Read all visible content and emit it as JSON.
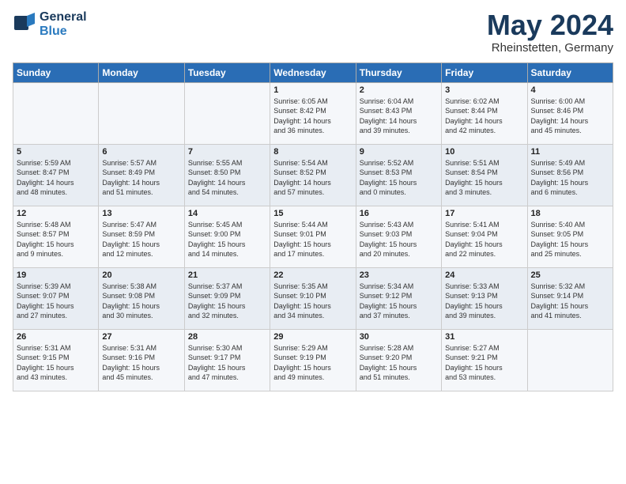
{
  "header": {
    "logo_line1": "General",
    "logo_line2": "Blue",
    "month": "May 2024",
    "location": "Rheinstetten, Germany"
  },
  "weekdays": [
    "Sunday",
    "Monday",
    "Tuesday",
    "Wednesday",
    "Thursday",
    "Friday",
    "Saturday"
  ],
  "weeks": [
    [
      {
        "day": "",
        "info": ""
      },
      {
        "day": "",
        "info": ""
      },
      {
        "day": "",
        "info": ""
      },
      {
        "day": "1",
        "info": "Sunrise: 6:05 AM\nSunset: 8:42 PM\nDaylight: 14 hours\nand 36 minutes."
      },
      {
        "day": "2",
        "info": "Sunrise: 6:04 AM\nSunset: 8:43 PM\nDaylight: 14 hours\nand 39 minutes."
      },
      {
        "day": "3",
        "info": "Sunrise: 6:02 AM\nSunset: 8:44 PM\nDaylight: 14 hours\nand 42 minutes."
      },
      {
        "day": "4",
        "info": "Sunrise: 6:00 AM\nSunset: 8:46 PM\nDaylight: 14 hours\nand 45 minutes."
      }
    ],
    [
      {
        "day": "5",
        "info": "Sunrise: 5:59 AM\nSunset: 8:47 PM\nDaylight: 14 hours\nand 48 minutes."
      },
      {
        "day": "6",
        "info": "Sunrise: 5:57 AM\nSunset: 8:49 PM\nDaylight: 14 hours\nand 51 minutes."
      },
      {
        "day": "7",
        "info": "Sunrise: 5:55 AM\nSunset: 8:50 PM\nDaylight: 14 hours\nand 54 minutes."
      },
      {
        "day": "8",
        "info": "Sunrise: 5:54 AM\nSunset: 8:52 PM\nDaylight: 14 hours\nand 57 minutes."
      },
      {
        "day": "9",
        "info": "Sunrise: 5:52 AM\nSunset: 8:53 PM\nDaylight: 15 hours\nand 0 minutes."
      },
      {
        "day": "10",
        "info": "Sunrise: 5:51 AM\nSunset: 8:54 PM\nDaylight: 15 hours\nand 3 minutes."
      },
      {
        "day": "11",
        "info": "Sunrise: 5:49 AM\nSunset: 8:56 PM\nDaylight: 15 hours\nand 6 minutes."
      }
    ],
    [
      {
        "day": "12",
        "info": "Sunrise: 5:48 AM\nSunset: 8:57 PM\nDaylight: 15 hours\nand 9 minutes."
      },
      {
        "day": "13",
        "info": "Sunrise: 5:47 AM\nSunset: 8:59 PM\nDaylight: 15 hours\nand 12 minutes."
      },
      {
        "day": "14",
        "info": "Sunrise: 5:45 AM\nSunset: 9:00 PM\nDaylight: 15 hours\nand 14 minutes."
      },
      {
        "day": "15",
        "info": "Sunrise: 5:44 AM\nSunset: 9:01 PM\nDaylight: 15 hours\nand 17 minutes."
      },
      {
        "day": "16",
        "info": "Sunrise: 5:43 AM\nSunset: 9:03 PM\nDaylight: 15 hours\nand 20 minutes."
      },
      {
        "day": "17",
        "info": "Sunrise: 5:41 AM\nSunset: 9:04 PM\nDaylight: 15 hours\nand 22 minutes."
      },
      {
        "day": "18",
        "info": "Sunrise: 5:40 AM\nSunset: 9:05 PM\nDaylight: 15 hours\nand 25 minutes."
      }
    ],
    [
      {
        "day": "19",
        "info": "Sunrise: 5:39 AM\nSunset: 9:07 PM\nDaylight: 15 hours\nand 27 minutes."
      },
      {
        "day": "20",
        "info": "Sunrise: 5:38 AM\nSunset: 9:08 PM\nDaylight: 15 hours\nand 30 minutes."
      },
      {
        "day": "21",
        "info": "Sunrise: 5:37 AM\nSunset: 9:09 PM\nDaylight: 15 hours\nand 32 minutes."
      },
      {
        "day": "22",
        "info": "Sunrise: 5:35 AM\nSunset: 9:10 PM\nDaylight: 15 hours\nand 34 minutes."
      },
      {
        "day": "23",
        "info": "Sunrise: 5:34 AM\nSunset: 9:12 PM\nDaylight: 15 hours\nand 37 minutes."
      },
      {
        "day": "24",
        "info": "Sunrise: 5:33 AM\nSunset: 9:13 PM\nDaylight: 15 hours\nand 39 minutes."
      },
      {
        "day": "25",
        "info": "Sunrise: 5:32 AM\nSunset: 9:14 PM\nDaylight: 15 hours\nand 41 minutes."
      }
    ],
    [
      {
        "day": "26",
        "info": "Sunrise: 5:31 AM\nSunset: 9:15 PM\nDaylight: 15 hours\nand 43 minutes."
      },
      {
        "day": "27",
        "info": "Sunrise: 5:31 AM\nSunset: 9:16 PM\nDaylight: 15 hours\nand 45 minutes."
      },
      {
        "day": "28",
        "info": "Sunrise: 5:30 AM\nSunset: 9:17 PM\nDaylight: 15 hours\nand 47 minutes."
      },
      {
        "day": "29",
        "info": "Sunrise: 5:29 AM\nSunset: 9:19 PM\nDaylight: 15 hours\nand 49 minutes."
      },
      {
        "day": "30",
        "info": "Sunrise: 5:28 AM\nSunset: 9:20 PM\nDaylight: 15 hours\nand 51 minutes."
      },
      {
        "day": "31",
        "info": "Sunrise: 5:27 AM\nSunset: 9:21 PM\nDaylight: 15 hours\nand 53 minutes."
      },
      {
        "day": "",
        "info": ""
      }
    ]
  ]
}
